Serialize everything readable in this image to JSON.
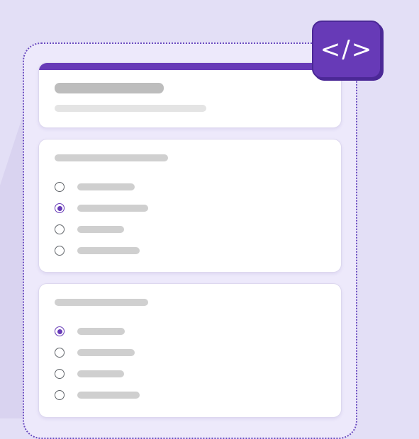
{
  "badge": {
    "icon": "code-brackets-icon",
    "text": "</>"
  },
  "colors": {
    "accent": "#673ab7",
    "background": "#e3dff6",
    "frame_border": "#6a4bc0"
  },
  "questions": [
    {
      "options": [
        {
          "selected": false
        },
        {
          "selected": true
        },
        {
          "selected": false
        },
        {
          "selected": false
        }
      ]
    },
    {
      "options": [
        {
          "selected": true
        },
        {
          "selected": false
        },
        {
          "selected": false
        },
        {
          "selected": false
        }
      ]
    }
  ]
}
